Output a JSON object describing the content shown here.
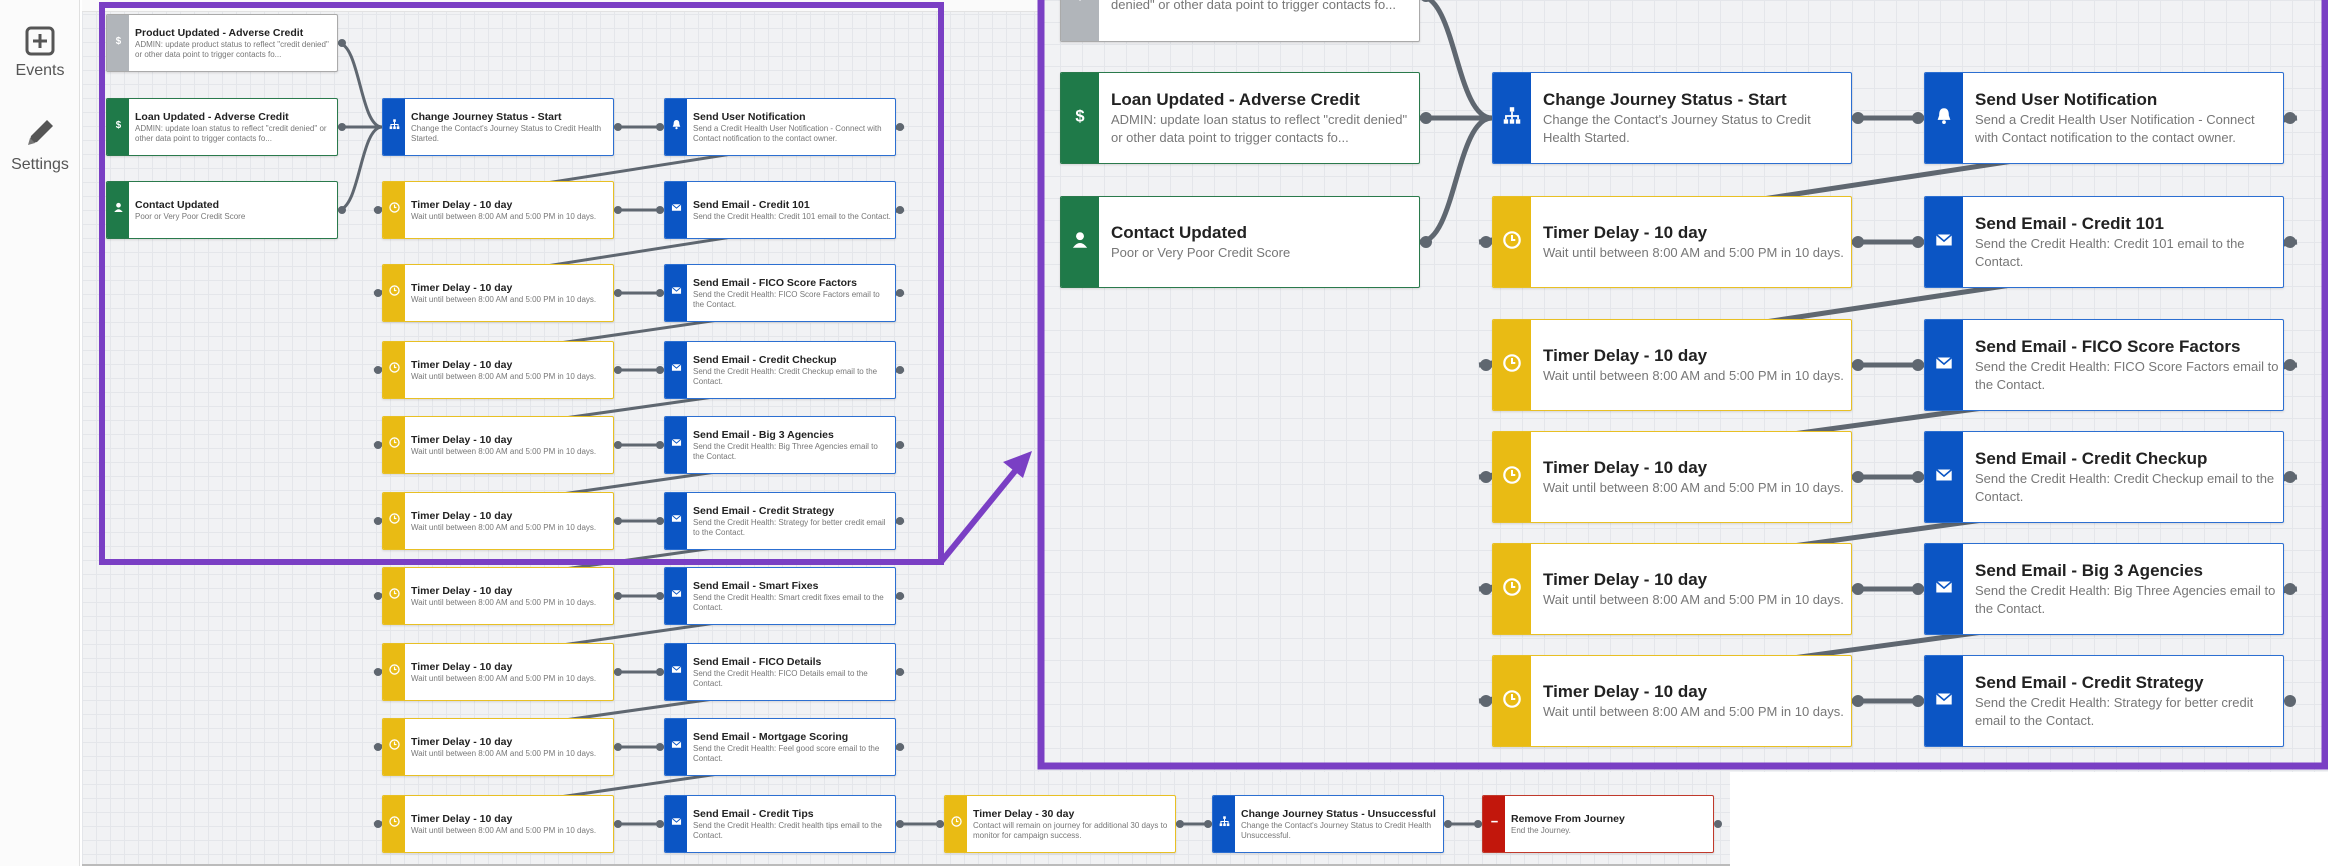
{
  "sidebar": {
    "items": [
      {
        "label": "Events",
        "icon": "plus-square-icon"
      },
      {
        "label": "Settings",
        "icon": "pencil-icon"
      }
    ]
  },
  "colors": {
    "trigger": "#1f7a49",
    "action": "#0b55c4",
    "timer": "#e9bb14",
    "inactive": "#b1b5ba",
    "end": "#c2170c",
    "highlight": "#7a3fc4"
  },
  "main_flow": {
    "triggers": [
      {
        "title": "Product Updated - Adverse Credit",
        "desc": "ADMIN: update product status to reflect \"credit denied\" or other data point to trigger contacts fo...",
        "icon": "dollar-icon",
        "style": "gray"
      },
      {
        "title": "Loan Updated - Adverse Credit",
        "desc": "ADMIN: update loan status to reflect \"credit denied\" or other data point to trigger contacts fo...",
        "icon": "dollar-icon",
        "style": "green"
      },
      {
        "title": "Contact Updated",
        "desc": "Poor or Very Poor Credit Score",
        "icon": "person-icon",
        "style": "green"
      }
    ],
    "start_status": {
      "title": "Change Journey Status - Start",
      "desc": "Change the Contact's Journey Status to Credit Health Started."
    },
    "notification": {
      "title": "Send User Notification",
      "desc": "Send a Credit Health User Notification - Connect with Contact notification to the contact owner."
    },
    "timer": {
      "title": "Timer Delay - 10 day",
      "desc": "Wait until between 8:00 AM and 5:00 PM in 10 days."
    },
    "emails": [
      {
        "title": "Send Email - Credit 101",
        "desc": "Send the Credit Health: Credit 101 email to the Contact."
      },
      {
        "title": "Send Email - FICO Score Factors",
        "desc": "Send the Credit Health: FICO Score Factors email to the Contact."
      },
      {
        "title": "Send Email - Credit Checkup",
        "desc": "Send the Credit Health: Credit Checkup email to the Contact."
      },
      {
        "title": "Send Email - Big 3 Agencies",
        "desc": "Send the Credit Health: Big Three Agencies email to the Contact."
      },
      {
        "title": "Send Email - Credit Strategy",
        "desc": "Send the Credit Health: Strategy for better credit email to the Contact."
      },
      {
        "title": "Send Email - Smart Fixes",
        "desc": "Send the Credit Health: Smart credit fixes email to the Contact."
      },
      {
        "title": "Send Email - FICO Details",
        "desc": "Send the Credit Health: FICO Details email to the Contact."
      },
      {
        "title": "Send Email - Mortgage Scoring",
        "desc": "Send the Credit Health: Feel good score email to the Contact."
      },
      {
        "title": "Send Email - Credit Tips",
        "desc": "Send the Credit Health: Credit health tips email to the Contact."
      }
    ],
    "final_timer": {
      "title": "Timer Delay - 30 day",
      "desc": "Contact will remain on journey for additional 30 days to monitor for campaign success."
    },
    "end_status": {
      "title": "Change Journey Status - Unsuccessful",
      "desc": "Change the Contact's Journey Status to Credit Health Unsuccessful."
    },
    "remove": {
      "title": "Remove From Journey",
      "desc": "End the Journey."
    }
  },
  "zoom_view": {
    "partial_trigger_desc": "ADMIN: update product status to reflect \"credit denied\" or other data point to trigger contacts fo..."
  }
}
